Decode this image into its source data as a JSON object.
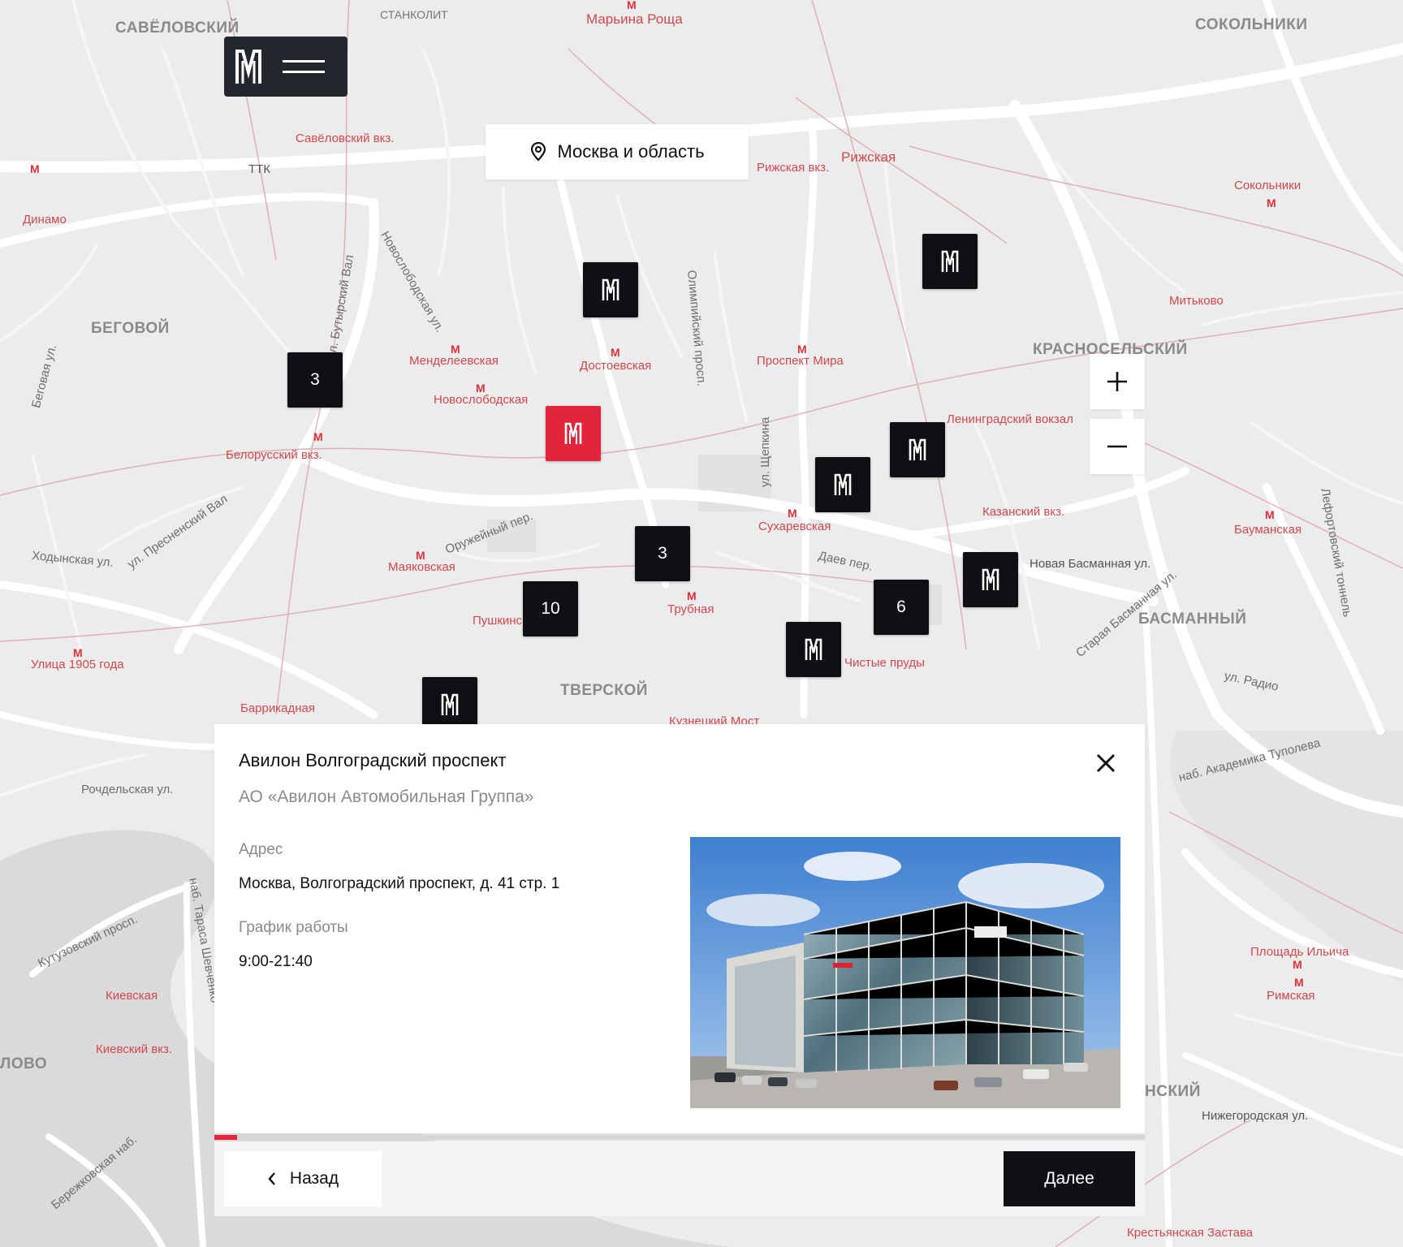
{
  "header": {
    "logo_icon": "brand-m-icon",
    "menu_icon": "hamburger-menu-icon"
  },
  "region": {
    "icon": "location-pin-icon",
    "label": "Москва и область"
  },
  "zoom": {
    "in_icon": "plus-icon",
    "out_icon": "minus-icon"
  },
  "colors": {
    "marker": "#0f0f14",
    "marker_active": "#e2253a",
    "accent": "#e2253a"
  },
  "map_labels": {
    "districts": [
      "САВЁЛОВСКИЙ",
      "СТАНКОЛИТ",
      "СОКОЛЬНИКИ",
      "БЕГОВОЙ",
      "КРАСНОСЕЛЬСКИЙ",
      "БАСМАННЫЙ",
      "ТВЕРСКОЙ",
      "ЛОВО",
      "НСКИЙ"
    ],
    "streets": [
      "ТТК",
      "Новослободская ул.",
      "Оружейный пер.",
      "ул. Бутырский Вал",
      "Беговая ул.",
      "Ходынская ул.",
      "ул. Пресненский Вал",
      "Новая Басманная ул.",
      "Кутузовский просп.",
      "Бережковская наб.",
      "наб. Академика Туполева",
      "Лефортовский тоннель",
      "ул. Радио",
      "Рочдельская ул.",
      "Даев пер.",
      "Олимпийский просп.",
      "ул. Щепкина",
      "Нижегородская ул.",
      "Старая Басманная ул.",
      "наб. Тараса Шевченко"
    ],
    "metro": [
      "Марьина Роща",
      "Савёловский вкз.",
      "Рижская",
      "Рижская вкз.",
      "Динамо",
      "Менделеевская",
      "Новослободская",
      "Достоевская",
      "Проспект Мира",
      "Белорусский вкз.",
      "Сухаревская",
      "Ленинградский вокзал",
      "Казанский вкз.",
      "Маяковская",
      "Трубная",
      "Пушкинская",
      "Баррикадная",
      "Улица 1905 года",
      "Сокольники",
      "Митьково",
      "Бауманская",
      "Киевская",
      "Киевский вкз.",
      "Площадь Ильича",
      "Римская",
      "Крестьянская Застава",
      "Чистые пруды",
      "Кузнецкий Мост"
    ]
  },
  "markers": [
    {
      "kind": "logo",
      "label": ""
    },
    {
      "kind": "logo",
      "label": ""
    },
    {
      "kind": "count",
      "label": "3"
    },
    {
      "kind": "logo",
      "label": "",
      "active": true
    },
    {
      "kind": "logo",
      "label": ""
    },
    {
      "kind": "logo",
      "label": ""
    },
    {
      "kind": "count",
      "label": "3"
    },
    {
      "kind": "count",
      "label": "10"
    },
    {
      "kind": "logo",
      "label": ""
    },
    {
      "kind": "count",
      "label": "6"
    },
    {
      "kind": "logo",
      "label": ""
    },
    {
      "kind": "logo",
      "label": ""
    }
  ],
  "card": {
    "title": "Авилон Волгоградский проспект",
    "company": "АО «Авилон Автомобильная Группа»",
    "address_label": "Адрес",
    "address_value": "Москва, Волгоградский проспект, д. 41 стр. 1",
    "hours_label": "График работы",
    "hours_value": "9:00-21:40",
    "close_icon": "close-icon",
    "photo": "dealership-building-photo"
  },
  "progress": {
    "fraction": 0.024
  },
  "footer": {
    "back_label": "Назад",
    "back_icon": "chevron-left-icon",
    "next_label": "Далее"
  }
}
